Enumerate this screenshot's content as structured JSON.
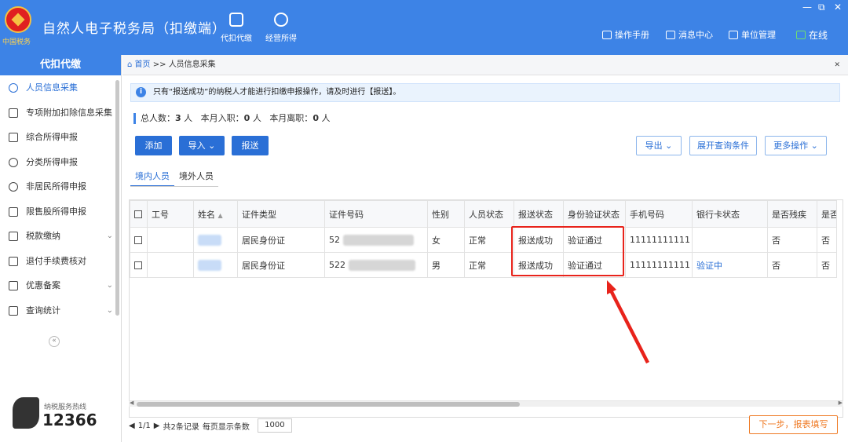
{
  "app": {
    "emblem_text": "中国税务",
    "title": "自然人电子税务局（扣缴端）",
    "modules": [
      {
        "label": "代扣代缴",
        "icon": "wallet-icon"
      },
      {
        "label": "经营所得",
        "icon": "coins-icon"
      }
    ],
    "window_controls": [
      "—",
      "⧉",
      "✕"
    ],
    "top_links": [
      {
        "label": "操作手册",
        "icon": "manual-icon"
      },
      {
        "label": "消息中心",
        "icon": "mail-icon"
      },
      {
        "label": "单位管理",
        "icon": "building-icon"
      },
      {
        "label": "在线",
        "icon": "online-monitor-icon"
      }
    ]
  },
  "sidebar": {
    "header": "代扣代缴",
    "items": [
      {
        "label": "人员信息采集",
        "icon": "person-icon",
        "active": true
      },
      {
        "label": "专项附加扣除信息采集",
        "icon": "list-icon"
      },
      {
        "label": "综合所得申报",
        "icon": "layers-icon"
      },
      {
        "label": "分类所得申报",
        "icon": "pie-icon"
      },
      {
        "label": "非居民所得申报",
        "icon": "person-outline-icon"
      },
      {
        "label": "限售股所得申报",
        "icon": "bar-chart-icon"
      },
      {
        "label": "税款缴纳",
        "icon": "card-icon",
        "expand": "⌄"
      },
      {
        "label": "退付手续费核对",
        "icon": "document-icon"
      },
      {
        "label": "优惠备案",
        "icon": "file-icon",
        "expand": "⌄"
      },
      {
        "label": "查询统计",
        "icon": "search-list-icon",
        "expand": "⌄"
      }
    ],
    "collapse_label": "«",
    "hotline_label": "纳税服务热线",
    "hotline_number": "12366"
  },
  "breadcrumb": {
    "home": "首页",
    "separator": ">>",
    "current": "人员信息采集",
    "close": "✕"
  },
  "notice": {
    "icon_glyph": "i",
    "text": "只有“报送成功”的纳税人才能进行扣缴申报操作，请及时进行【报送】。"
  },
  "stats": {
    "total_label": "总人数：",
    "total_value": "3",
    "total_unit": "人",
    "hired_label": "本月入职：",
    "hired_value": "0",
    "hired_unit": "人",
    "left_label": "本月离职：",
    "left_value": "0",
    "left_unit": "人"
  },
  "toolbar": {
    "add": "添加",
    "import": "导入",
    "import_chevron": "⌄",
    "submit": "报送",
    "export": "导出",
    "export_chevron": "⌄",
    "expand_query": "展开查询条件",
    "more": "更多操作",
    "more_chevron": "⌄"
  },
  "tabs": [
    "境内人员",
    "境外人员"
  ],
  "table": {
    "columns": [
      "工号",
      "姓名",
      "证件类型",
      "证件号码",
      "性别",
      "人员状态",
      "报送状态",
      "身份验证状态",
      "手机号码",
      "银行卡状态",
      "是否残疾",
      "是否烈属"
    ],
    "name_sort_glyph": "▲",
    "rows": [
      {
        "id_type": "居民身份证",
        "id_prefix": "52",
        "gender": "女",
        "status": "正常",
        "submit_status": "报送成功",
        "verify_status": "验证通过",
        "phone": "11111111111",
        "bank_status": "",
        "disabled": "否",
        "martyr": "否"
      },
      {
        "id_type": "居民身份证",
        "id_prefix": "522",
        "gender": "男",
        "status": "正常",
        "submit_status": "报送成功",
        "verify_status": "验证通过",
        "phone": "11111111111",
        "bank_status": "验证中",
        "disabled": "否",
        "martyr": "否"
      }
    ]
  },
  "pager": {
    "prev": "◀",
    "page": "1/1",
    "next": "▶",
    "records": "共2条记录",
    "per_page_label": "每页显示条数",
    "per_page_value": "1000"
  },
  "next_button": "下一步，报表填写",
  "colors": {
    "brand_blue": "#3d83e6",
    "accent_blue": "#2a6fd6",
    "annotation_red": "#e8231b",
    "next_orange": "#ef7a24"
  }
}
